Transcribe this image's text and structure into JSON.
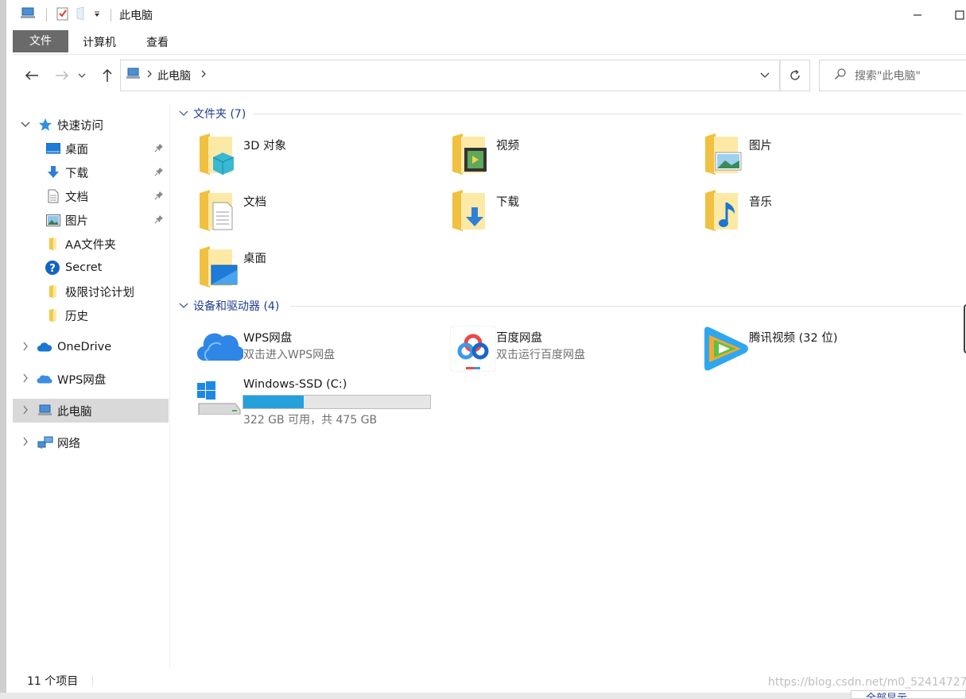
{
  "window": {
    "title": "此电脑"
  },
  "ribbon": {
    "tabs": [
      "文件",
      "计算机",
      "查看"
    ]
  },
  "address": {
    "path": "此电脑"
  },
  "search": {
    "placeholder": "搜索\"此电脑\""
  },
  "sidebar": {
    "quick_access": "快速访问",
    "items": [
      {
        "label": "桌面",
        "pinned": true
      },
      {
        "label": "下载",
        "pinned": true
      },
      {
        "label": "文档",
        "pinned": true
      },
      {
        "label": "图片",
        "pinned": true
      },
      {
        "label": "AA文件夹",
        "pinned": false
      },
      {
        "label": "Secret",
        "pinned": false
      },
      {
        "label": "极限讨论计划",
        "pinned": false
      },
      {
        "label": "历史",
        "pinned": false
      }
    ],
    "onedrive": "OneDrive",
    "wps": "WPS网盘",
    "this_pc": "此电脑",
    "network": "网络"
  },
  "folders": {
    "header": "文件夹 (7)",
    "items": [
      "3D 对象",
      "视频",
      "图片",
      "文档",
      "下载",
      "音乐",
      "桌面"
    ]
  },
  "devices": {
    "header": "设备和驱动器 (4)",
    "items": [
      {
        "name": "WPS网盘",
        "sub": "双击进入WPS网盘"
      },
      {
        "name": "百度网盘",
        "sub": "双击运行百度网盘"
      },
      {
        "name": "腾讯视频 (32 位)",
        "sub": ""
      },
      {
        "name": "Windows-SSD (C:)",
        "sub": "322 GB 可用，共 475 GB",
        "used_fraction": 0.322
      }
    ]
  },
  "status": {
    "count": "11 个项目"
  },
  "bottom": {
    "label": "全部显示"
  },
  "watermark": "https://blog.csdn.net/m0_52414727",
  "colors": {
    "accent": "#1e3d8f",
    "drive_fill": "#26a0da",
    "selected": "#d9d9d9"
  }
}
